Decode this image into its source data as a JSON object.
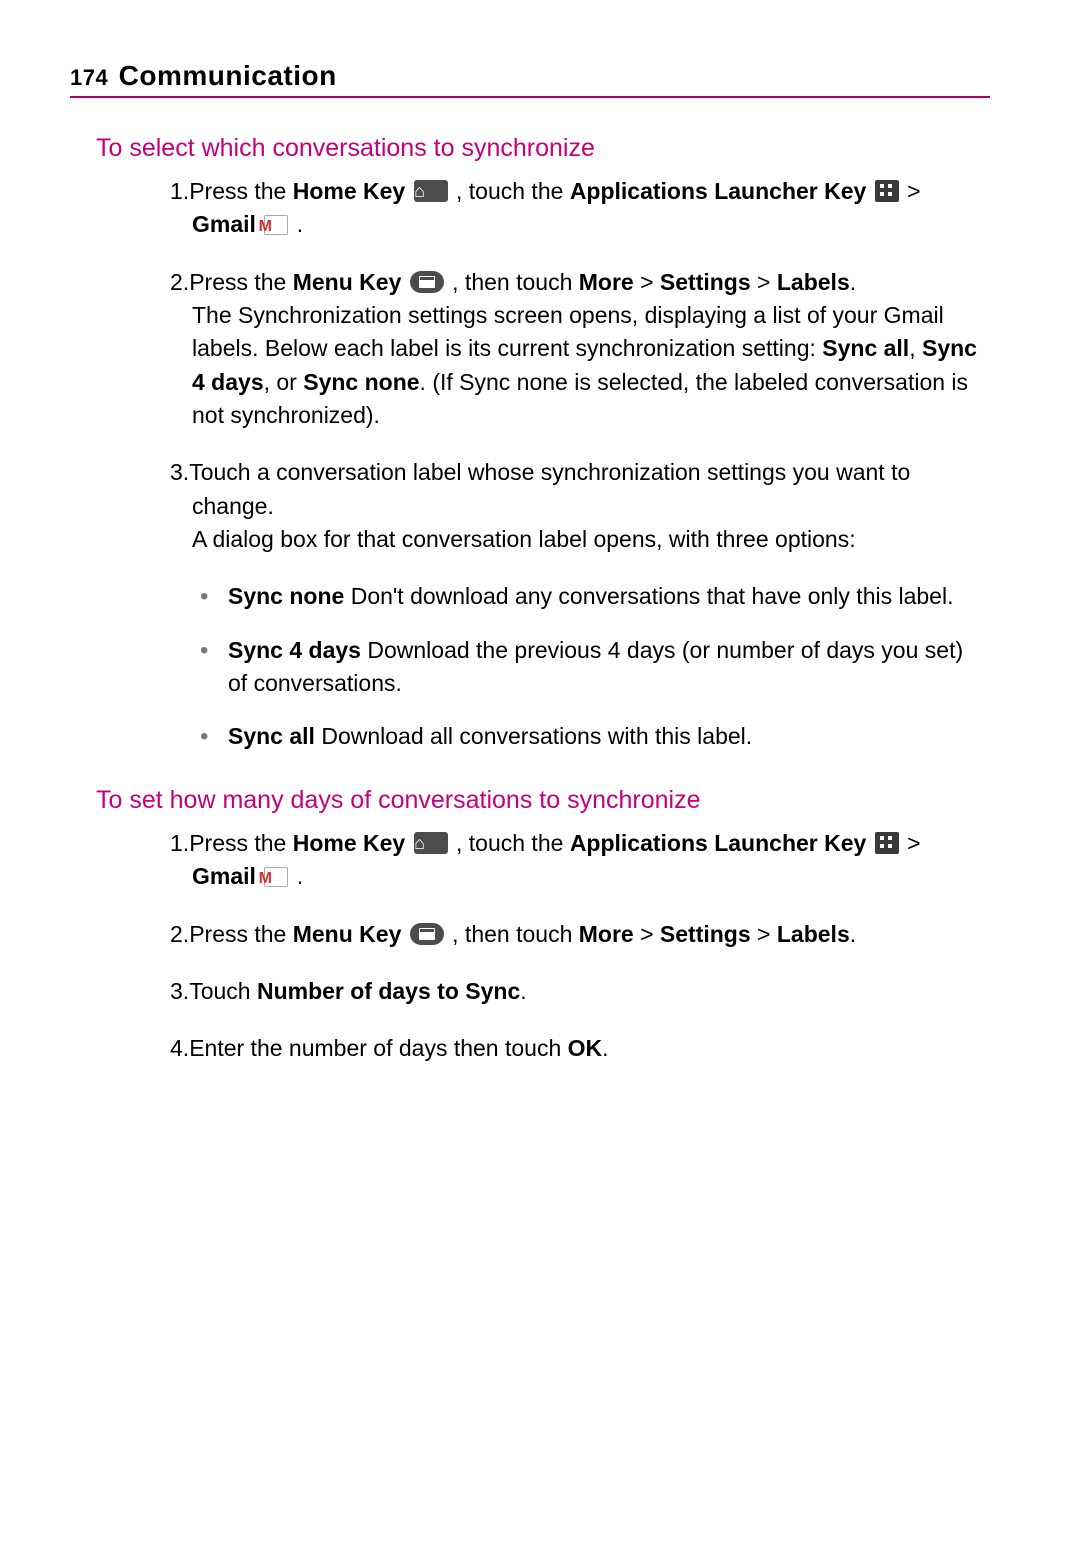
{
  "header": {
    "page_number": "174",
    "chapter": "Communication"
  },
  "section1": {
    "title": "To select which conversations to synchronize",
    "steps": {
      "s1": {
        "num": "1.",
        "t1": "Press the ",
        "b1": "Home Key",
        "t2": " , touch the ",
        "b2": "Applications Launcher Key",
        "t3": " > ",
        "b3": "Gmail",
        "t4": " ."
      },
      "s2": {
        "num": "2.",
        "t1": "Press the ",
        "b1": "Menu Key",
        "t2": " , then touch ",
        "b2": "More",
        "t3": " > ",
        "b3": "Settings",
        "t4": " > ",
        "b4": "Labels",
        "t5": ".",
        "para1a": "The Synchronization settings screen opens, displaying a list of your Gmail labels. Below each label is its current synchronization setting: ",
        "b5": "Sync all",
        "p1b": ", ",
        "b6": "Sync 4 days",
        "p1c": ", or ",
        "b7": "Sync none",
        "p1d": ". (If Sync none is selected, the labeled conversation is not synchronized)."
      },
      "s3": {
        "num": "3.",
        "t1": "Touch a conversation label whose synchronization settings you want to change.",
        "para2": "A dialog box for that conversation label opens, with three options:"
      }
    },
    "bullets": {
      "b1_bold": "Sync none",
      "b1_text": "  Don't download any conversations that have only this label.",
      "b2_bold": "Sync 4 days",
      "b2_text": "  Download the previous 4 days (or number of days you set) of conversations.",
      "b3_bold": "Sync all",
      "b3_text": " Download all conversations with this label."
    }
  },
  "section2": {
    "title": "To set how many days of conversations to synchronize",
    "steps": {
      "s1": {
        "num": "1.",
        "t1": "Press the ",
        "b1": "Home Key",
        "t2": " , touch the ",
        "b2": "Applications Launcher Key",
        "t3": " > ",
        "b3": "Gmail",
        "t4": " ."
      },
      "s2": {
        "num": "2.",
        "t1": "Press the ",
        "b1": "Menu Key",
        "t2": " , then touch ",
        "b2": "More",
        "t3": " > ",
        "b3": "Settings",
        "t4": " > ",
        "b4": "Labels",
        "t5": "."
      },
      "s3": {
        "num": "3.",
        "t1": "Touch ",
        "b1": "Number of days to Sync",
        "t2": "."
      },
      "s4": {
        "num": "4.",
        "t1": "Enter the number of days then touch ",
        "b1": "OK",
        "t2": "."
      }
    }
  }
}
